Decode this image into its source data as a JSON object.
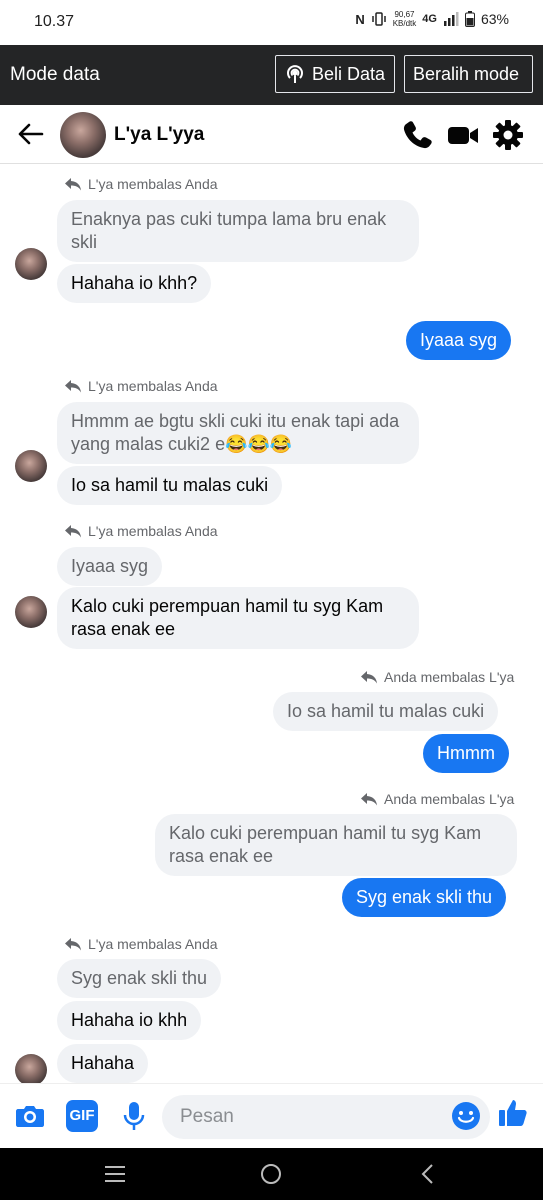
{
  "status_bar": {
    "time": "10.37",
    "net_speed_top": "90,67",
    "net_speed_bottom": "KB/dtk",
    "network": "4G",
    "battery": "63%"
  },
  "data_bar": {
    "title": "Mode data",
    "buy_label": "Beli Data",
    "switch_label": "Beralih mode"
  },
  "header": {
    "name": "L'ya L'yya"
  },
  "messages": [
    {
      "reply_label": "L'ya membalas Anda"
    },
    {
      "quoted": "Enaknya pas cuki tumpa lama bru enak skli"
    },
    {
      "text": "Hahaha io khh?"
    },
    {
      "text": "Iyaaa syg"
    },
    {
      "reply_label": "L'ya membalas Anda"
    },
    {
      "quoted": "Hmmm ae bgtu skli  cuki itu enak tapi ada yang malas cuki2 e😂😂😂"
    },
    {
      "text": "Io sa hamil tu malas cuki"
    },
    {
      "reply_label": "L'ya membalas Anda"
    },
    {
      "quoted": "Iyaaa syg"
    },
    {
      "text": "Kalo cuki perempuan hamil tu syg Kam rasa enak ee"
    },
    {
      "reply_label": "Anda membalas L'ya"
    },
    {
      "quoted": "Io sa hamil tu malas cuki"
    },
    {
      "text": "Hmmm"
    },
    {
      "reply_label": "Anda membalas L'ya"
    },
    {
      "quoted": "Kalo cuki perempuan hamil tu syg Kam rasa enak ee"
    },
    {
      "text": "Syg enak skli thu"
    },
    {
      "reply_label": "L'ya membalas Anda"
    },
    {
      "quoted": "Syg enak skli thu"
    },
    {
      "text": "Hahaha io khh"
    },
    {
      "text": "Hahaha"
    }
  ],
  "composer": {
    "placeholder": "Pesan",
    "gif_label": "GIF"
  },
  "colors": {
    "accent": "#1877f2",
    "dark_bar": "#242526",
    "bubble_in": "#f0f2f5"
  }
}
